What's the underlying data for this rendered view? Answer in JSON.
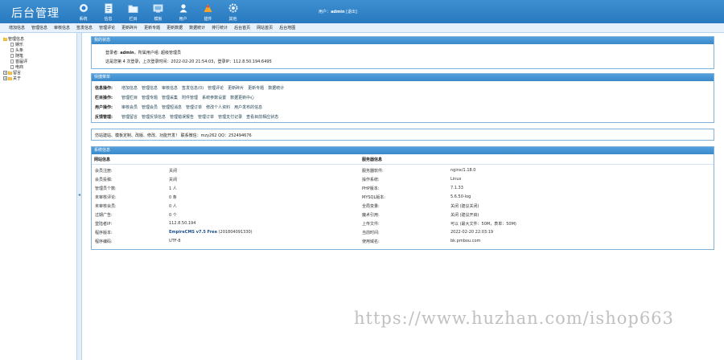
{
  "header": {
    "logo": "后台管理",
    "nav": [
      {
        "label": "系统",
        "icon": "system-icon"
      },
      {
        "label": "信息",
        "icon": "info-doc-icon"
      },
      {
        "label": "栏目",
        "icon": "folder-icon"
      },
      {
        "label": "模板",
        "icon": "template-icon"
      },
      {
        "label": "用户",
        "icon": "user-icon"
      },
      {
        "label": "插件",
        "icon": "plugin-icon"
      },
      {
        "label": "其他",
        "icon": "gear-icon"
      }
    ],
    "user_prefix": "用户：",
    "user_name": "admin",
    "logout": "[退出]"
  },
  "menubar": [
    "增加信息",
    "管理信息",
    "审核信息",
    "签发信息",
    "管理评论",
    "更新碎片",
    "更新专题",
    "更新数据",
    "数据统计",
    "排行统计",
    "后台首页",
    "网站首页",
    "后台地图"
  ],
  "sidebar": {
    "root": "管理信息",
    "children": [
      "娱乐",
      "头条",
      "随笔",
      "首届评",
      "电商"
    ],
    "others": [
      "留言",
      "关于"
    ]
  },
  "panel_login": {
    "title": "我的状态",
    "login_label": "登录者:",
    "login_user": "admin",
    "group_text": "，所属用户组: 超级管理员",
    "stats_text": "这是您第 4 次登录，上次登录时间：2022-02-20 21:54:03，登录IP：112.8.50.194:6495"
  },
  "panel_shortcuts": {
    "title": "快捷菜单",
    "rows": [
      {
        "label": "信息操作:",
        "links": [
          "增加信息",
          "管理信息",
          "审核信息",
          "签发信息(0)",
          "管理评论",
          "更新碎片",
          "更新专题",
          "数据统计"
        ]
      },
      {
        "label": "栏目操作:",
        "links": [
          "管理栏目",
          "管理专题",
          "管理采集",
          "附件管理",
          "系统参数设置",
          "数据更新中心"
        ]
      },
      {
        "label": "用户操作:",
        "links": [
          "审核会员",
          "管理会员",
          "管理短消息",
          "管理订单",
          "修改个人资料",
          "用户发布的信息"
        ]
      },
      {
        "label": "反馈管理:",
        "links": [
          "管理留言",
          "管理反馈信息",
          "管理错误报告",
          "管理订单",
          "管理支付记录",
          "查看目前相应状态"
        ]
      }
    ]
  },
  "panel_notice": {
    "text": "仿站建站、模板定制、改版、修改、功能开发！ 联系微信：mzy262 QQ：252494676"
  },
  "panel_system": {
    "title": "系统信息",
    "left_header": "网站信息",
    "right_header": "服务器信息",
    "left_rows": [
      {
        "k": "会员注册:",
        "v": "关闭"
      },
      {
        "k": "会员投稿:",
        "v": "关闭"
      },
      {
        "k": "管理员个数:",
        "v": "1 人"
      },
      {
        "k": "未审核评论:",
        "v": "0 条"
      },
      {
        "k": "未审核会员:",
        "v": "0 人"
      },
      {
        "k": "过期广告:",
        "v": "0 个"
      },
      {
        "k": "登陆者IP:",
        "v": "112.8.50.194"
      },
      {
        "k": "程序版本:",
        "v": "EmpireCMS v7.5 Free",
        "extra": "(201804091330)"
      },
      {
        "k": "程序编码:",
        "v": "UTF-8"
      }
    ],
    "right_rows": [
      {
        "k": "服务器软件:",
        "v": "nginx/1.18.0"
      },
      {
        "k": "操作系统:",
        "v": "Linux"
      },
      {
        "k": "PHP版本:",
        "v": "7.1.33"
      },
      {
        "k": "MYSQL版本:",
        "v": "5.6.50-log"
      },
      {
        "k": "全局变量:",
        "v": "关闭 (建议关闭)"
      },
      {
        "k": "魔术引用:",
        "v": "关闭 (建议开启)"
      },
      {
        "k": "上传文件:",
        "v": "可以 (最大文件：50M，表单：50M)"
      },
      {
        "k": "当前时间:",
        "v": "2022-02-20 22:03:19"
      },
      {
        "k": "使用域名:",
        "v": "bk.pmbou.com"
      }
    ]
  },
  "watermark": "https://www.huzhan.com/ishop663"
}
